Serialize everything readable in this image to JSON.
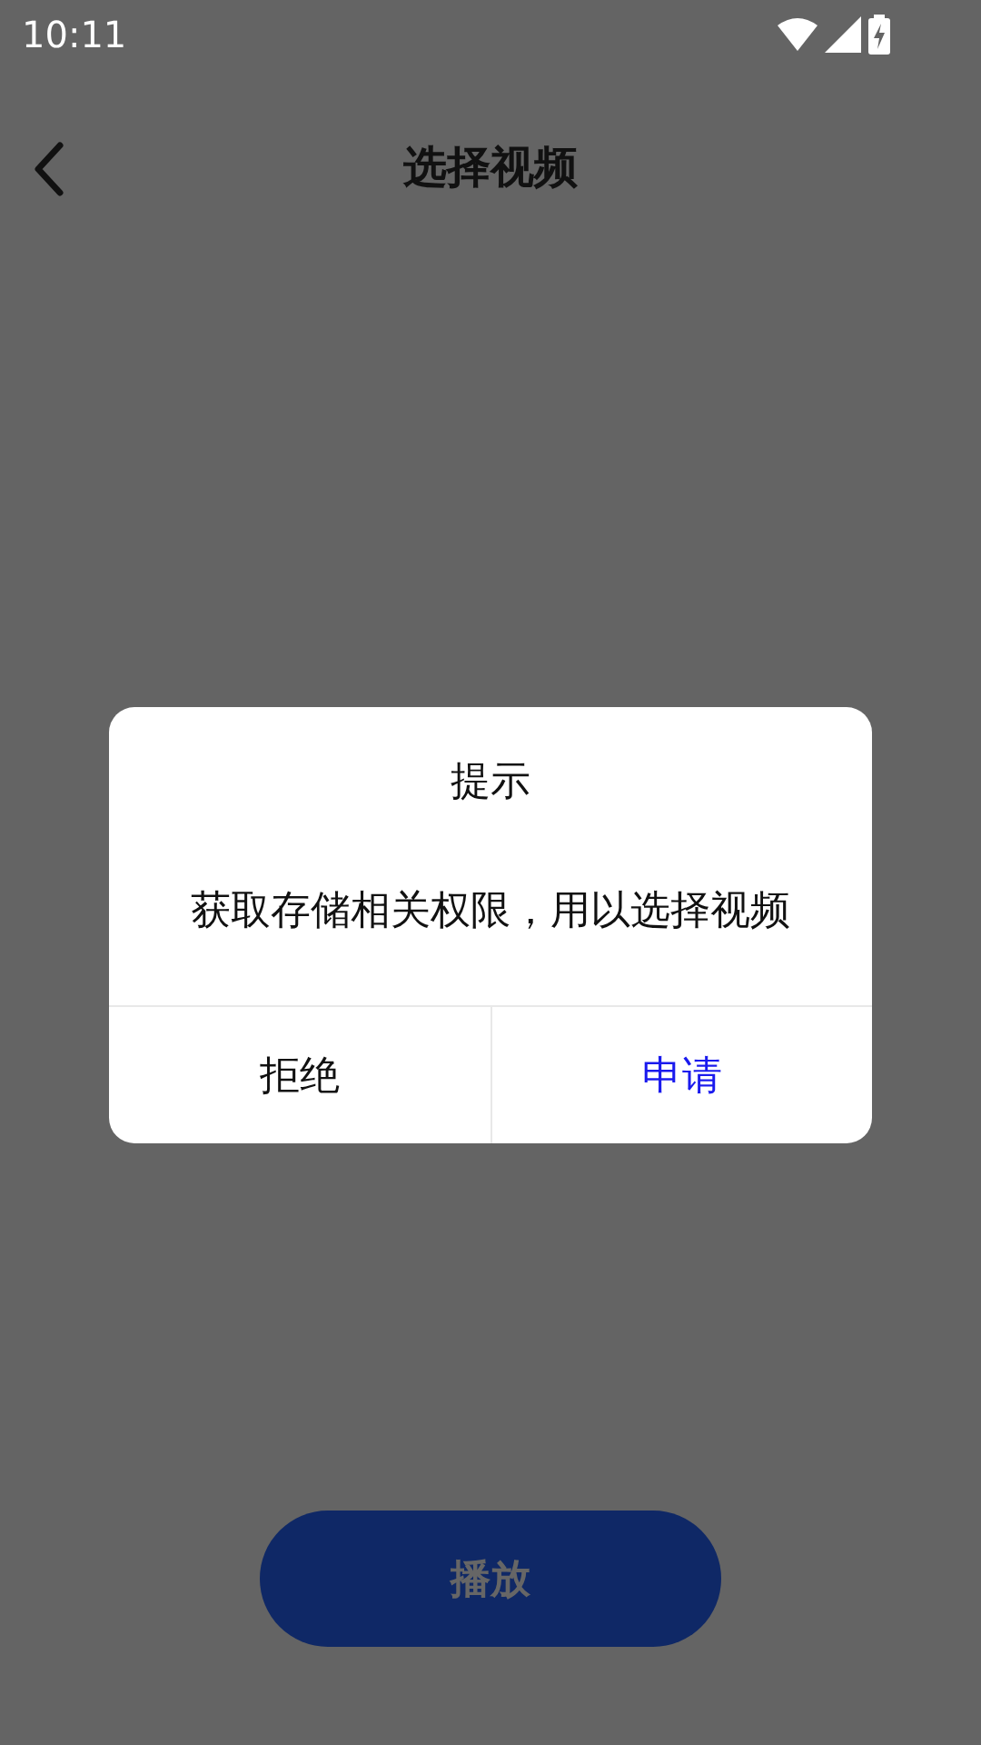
{
  "status_bar": {
    "time": "10:11"
  },
  "header": {
    "title": "选择视频"
  },
  "play_button": {
    "label": "播放"
  },
  "dialog": {
    "title": "提示",
    "message": "获取存储相关权限，用以选择视频",
    "buttons": [
      {
        "label": "拒绝",
        "kind": "cancel"
      },
      {
        "label": "申请",
        "kind": "confirm"
      }
    ]
  }
}
